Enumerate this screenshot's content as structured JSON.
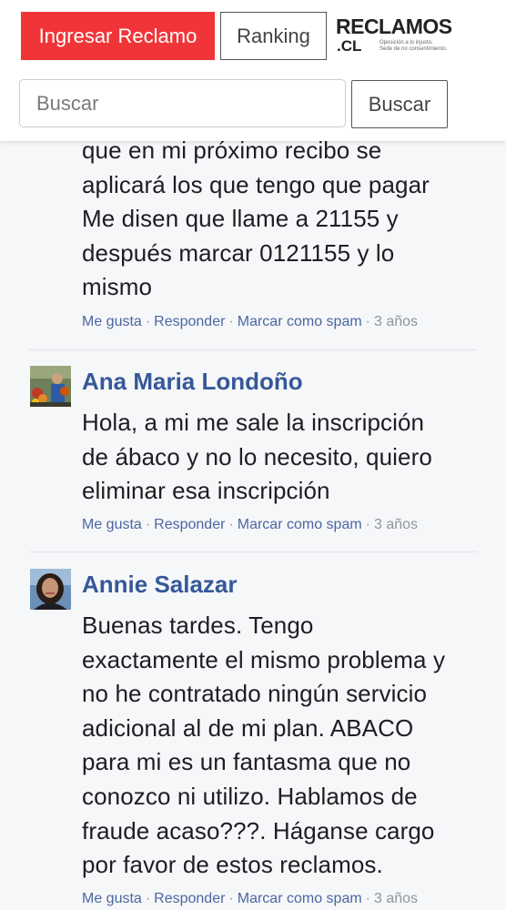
{
  "header": {
    "primary_button": "Ingresar Reclamo",
    "ranking_button": "Ranking",
    "logo": {
      "name": "RECLAMOS",
      "suffix": ".CL",
      "tagline_1": "Oposición a lo injusto.",
      "tagline_2": "Sede de no consentimiento."
    },
    "search": {
      "placeholder": "Buscar",
      "button": "Buscar"
    }
  },
  "comments": [
    {
      "text_lines": [
        "que en mi próximo recibo se",
        "aplicará los que tengo que pagar",
        "Me disen que llame a 21155 y",
        "después marcar 0121155 y lo",
        "mismo"
      ],
      "like": "Me gusta",
      "reply": "Responder",
      "spam": "Marcar como spam",
      "time": "3 años"
    },
    {
      "author": "Ana Maria Londoño",
      "text_lines": [
        "Hola, a mi me sale la inscripción",
        "de ábaco y no lo necesito, quiero",
        "eliminar esa inscripción"
      ],
      "like": "Me gusta",
      "reply": "Responder",
      "spam": "Marcar como spam",
      "time": "3 años"
    },
    {
      "author": "Annie Salazar",
      "text_lines": [
        "Buenas tardes. Tengo",
        "exactamente el mismo problema y",
        "no he contratado ningún servicio",
        "adicional al de mi plan. ABACO",
        "para mi es un fantasma que no",
        "conozco ni utilizo. Hablamos de",
        "fraude acaso???. Háganse cargo",
        "por favor de estos reclamos."
      ],
      "like": "Me gusta",
      "reply": "Responder",
      "spam": "Marcar como spam",
      "time": "3 años"
    }
  ],
  "separator": "·",
  "colors": {
    "primary": "#f03538",
    "link": "#4b67a1",
    "author": "#365899",
    "meta": "#90949c",
    "text": "#1c1e21"
  }
}
